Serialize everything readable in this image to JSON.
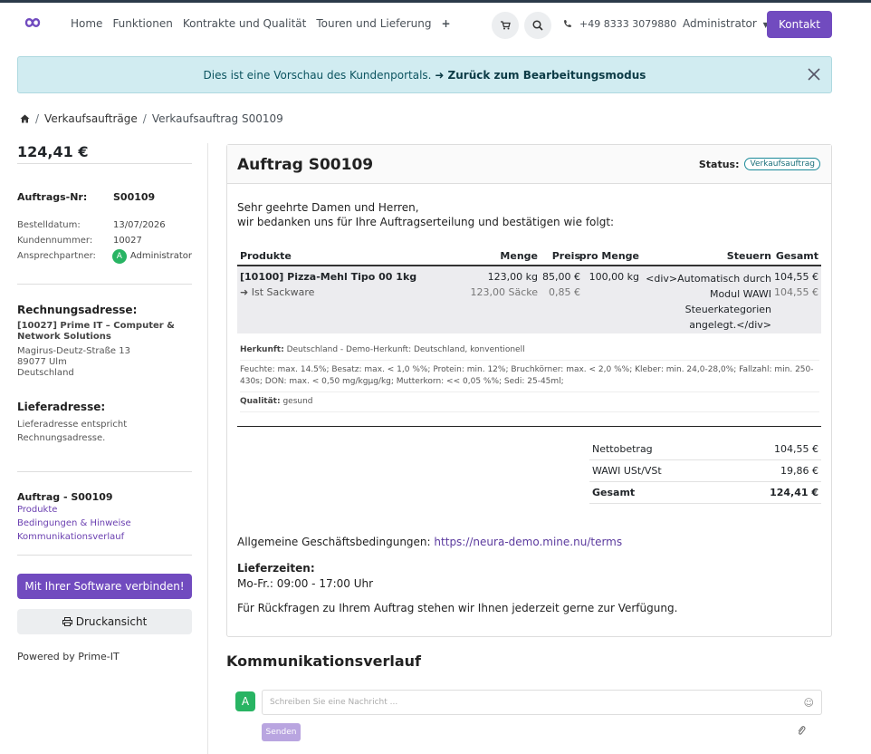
{
  "nav": {
    "links": [
      "Home",
      "Funktionen",
      "Kontrakte und Qualität",
      "Touren und Lieferung"
    ],
    "plus": "+",
    "phone": "+49 8333 3079880",
    "user": "Administrator",
    "contact_button": "Kontakt"
  },
  "alert": {
    "text": "Dies ist eine Vorschau des Kundenportals.",
    "link": "➜ Zurück zum Bearbeitungsmodus"
  },
  "breadcrumb": {
    "items": [
      "Verkaufsaufträge",
      "Verkaufsauftrag S00109"
    ],
    "sep": "/"
  },
  "sidebar": {
    "amount": "124,41 €",
    "order_label": "Auftrags-Nr:",
    "order_value": "S00109",
    "date_label": "Bestelldatum:",
    "date_value": "13/07/2026",
    "customer_label": "Kundennummer:",
    "customer_value": "10027",
    "contact_label": "Ansprechpartner:",
    "contact_initial": "A",
    "contact_value": "Administrator",
    "billing_title": "Rechnungsadresse:",
    "billing_company": "[10027] Prime IT – Computer & Network Solutions",
    "billing_street": "Magirus-Deutz-Straße 13",
    "billing_city": "89077 Ulm",
    "billing_country": "Deutschland",
    "delivery_title": "Lieferadresse:",
    "delivery_text": "Lieferadresse entspricht Rechnungsadresse.",
    "nav_title": "Auftrag - S00109",
    "nav_links": [
      "Produkte",
      "Bedingungen & Hinweise",
      "Kommunikationsverlauf"
    ],
    "connect_button": "Mit Ihrer Software verbinden!",
    "print_button": "Druckansicht",
    "powered": "Powered by Prime-IT"
  },
  "card": {
    "title": "Auftrag S00109",
    "status_label": "Status:",
    "status_value": "Verkaufsauftrag",
    "greeting_1": "Sehr geehrte Damen und Herren,",
    "greeting_2": "wir bedanken uns für Ihre Auftragserteilung und bestätigen wie folgt:",
    "columns": {
      "product": "Produkte",
      "qty": "Menge",
      "price": "Preis",
      "per": "pro Menge",
      "tax": "Steuern",
      "total": "Gesamt"
    },
    "row": {
      "product": "[10100] Pizza-Mehl Tipo 00 1kg",
      "qty": "123,00 kg",
      "price": "85,00 €",
      "per": "100,00 kg",
      "tax_1": "<div>Automatisch durch",
      "tax_2": "Modul WAWI",
      "tax_3": "Steuerkategorien",
      "tax_4": "angelegt.</div>",
      "total": "104,55 €",
      "sub_product": "➜ Ist Sackware",
      "sub_qty": "123,00 Säcke",
      "sub_price": "0,85 €",
      "sub_total": "104,55 €"
    },
    "notes": {
      "origin_label": "Herkunft:",
      "origin_value": "Deutschland - Demo-Herkunft: Deutschland, konventionell",
      "quality_line": "Feuchte: max. 14.5%; Besatz: max. < 1,0 %%; Protein: min. 12%; Bruchkörner: max. < 2,0 %%; Kleber: min. 24,0-28,0%; Fallzahl: min. 250-430s; DON: max. < 0,50 mg/kgµg/kg; Mutterkorn: << 0,05 %%; Sedi: 25-45ml;",
      "quality_label": "Qualität:",
      "quality_value": "gesund"
    },
    "totals": {
      "net_label": "Nettobetrag",
      "net_value": "104,55 €",
      "tax_label": "WAWI USt/VSt",
      "tax_value": "19,86 €",
      "total_label": "Gesamt",
      "total_value": "124,41 €"
    },
    "terms_label": "Allgemeine Geschäftsbedingungen:",
    "terms_link": "https://neura-demo.mine.nu/terms",
    "delivery_times_label": "Lieferzeiten:",
    "delivery_times_value": "Mo-Fr.: 09:00 - 17:00 Uhr",
    "closing": "Für Rückfragen zu Ihrem Auftrag stehen wir Ihnen jederzeit gerne zur Verfügung."
  },
  "communication": {
    "title": "Kommunikationsverlauf",
    "avatar": "A",
    "placeholder": "Schreiben Sie eine Nachricht ...",
    "send": "Senden"
  },
  "colors": {
    "primary": "#714bbf",
    "alert_bg": "#d1ecf1",
    "avatar": "#28b463"
  },
  "icons": [
    "logo-icon",
    "cart-icon",
    "search-icon",
    "phone-icon",
    "close-icon",
    "home-icon",
    "print-icon",
    "smiley-icon",
    "paperclip-icon"
  ]
}
